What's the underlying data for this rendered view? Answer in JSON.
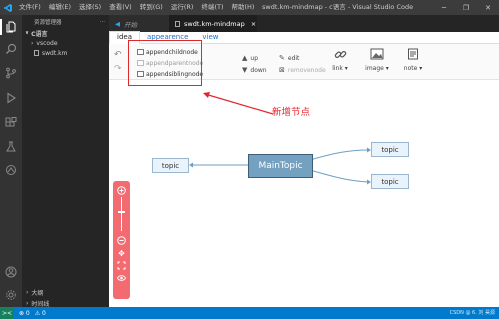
{
  "titlebar": {
    "menu": [
      "文件(F)",
      "编辑(E)",
      "选择(S)",
      "查看(V)",
      "转到(G)",
      "运行(R)",
      "终端(T)",
      "帮助(H)"
    ],
    "title": "swdt.km-mindmap - c语言 - Visual Studio Code",
    "controls": [
      "minimize-icon",
      "maximize-icon",
      "close-icon"
    ]
  },
  "sidebar": {
    "header": "资源管理器",
    "more": "···",
    "folder": "C语言",
    "items": [
      {
        "label": "vscode"
      },
      {
        "label": "swdt.km"
      }
    ],
    "outline": "大纲",
    "timeline": "时间线"
  },
  "tabs": [
    {
      "label": "开始"
    },
    {
      "label": "swdt.km-mindmap",
      "close": "×"
    }
  ],
  "mindmap": {
    "tabs": [
      "idea",
      "appearence",
      "view"
    ],
    "insert": [
      {
        "label": "appendchildnode",
        "disabled": false
      },
      {
        "label": "appendparentnode",
        "disabled": true
      },
      {
        "label": "appendsiblingnode",
        "disabled": false
      }
    ],
    "edit_buttons": [
      {
        "label": "up",
        "symbol": "▲"
      },
      {
        "label": "down",
        "symbol": "▼"
      },
      {
        "label": "edit",
        "symbol": "✎"
      },
      {
        "label": "removenode",
        "symbol": "⊠"
      }
    ],
    "big_buttons": [
      {
        "label": "link",
        "caret": "▾"
      },
      {
        "label": "image",
        "caret": "▾"
      },
      {
        "label": "note",
        "caret": "▾"
      }
    ],
    "annotation": "新增节点",
    "nodes": {
      "main": "MainTopic",
      "left": "topic",
      "right_top": "topic",
      "right_bottom": "topic"
    }
  },
  "statusbar": {
    "remote": "><",
    "errors": "⊗ 0",
    "warnings": "⚠ 0",
    "watermark": "CSDN @ 6. 刘 昊源"
  },
  "colors": {
    "accent": "#007acc",
    "annotation": "#e0272c",
    "main_node": "#73a1bf",
    "zoombar": "#f26b71"
  }
}
